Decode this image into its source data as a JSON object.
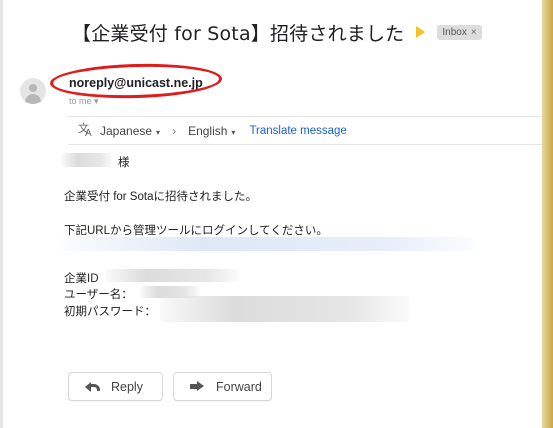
{
  "email": {
    "subject": "【企業受付 for Sota】招待されました",
    "label": "Inbox",
    "label_close": "×",
    "sender": "noreply@unicast.ne.jp",
    "recipient_line": "to me ▾"
  },
  "translate": {
    "from_lang": "Japanese",
    "to_lang": "English",
    "separator": "›",
    "action": "Translate message",
    "caret": "▾"
  },
  "body": {
    "greeting_suffix": "様",
    "line1": "企業受付 for Sotaに招待されました。",
    "line2": "下記URLから管理ツールにログインしてください。",
    "company_id_label": "企業ID",
    "username_label": "ユーザー名：",
    "password_label": "初期パスワード："
  },
  "actions": {
    "reply_label": "Reply",
    "forward_label": "Forward"
  },
  "icons": {
    "importance": "importance-marker-icon",
    "avatar": "person-avatar-icon",
    "translate": "translate-icon",
    "reply": "reply-arrow-icon",
    "forward": "forward-arrow-icon"
  },
  "colors": {
    "annotation_circle": "#e01b1b",
    "importance_marker": "#f6c026",
    "link": "#1a62c7",
    "label_chip_bg": "#dddddd"
  }
}
